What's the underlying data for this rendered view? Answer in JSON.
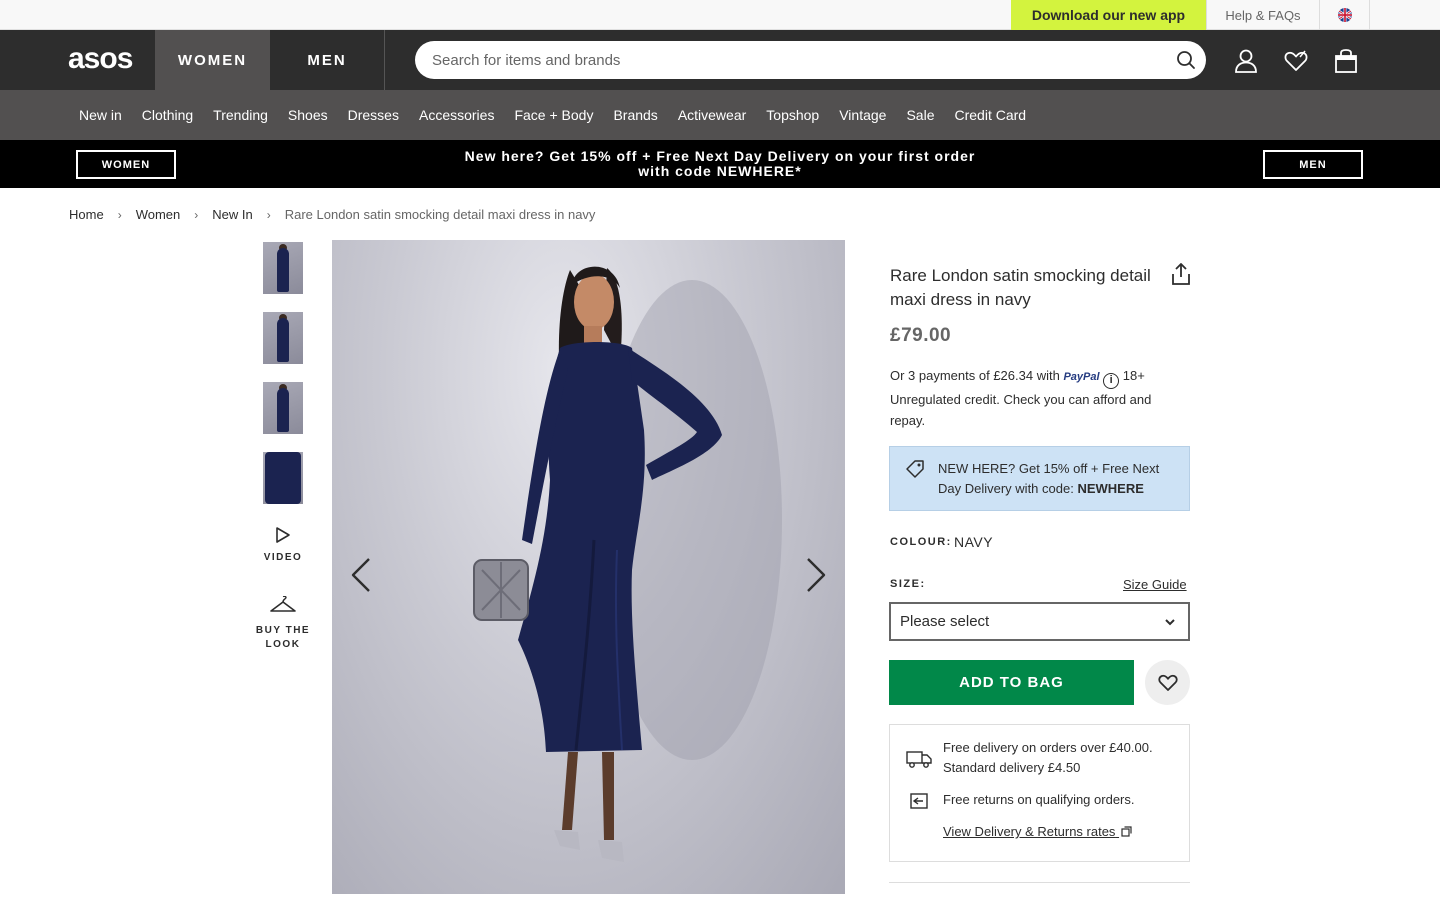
{
  "utility": {
    "download_app": "Download our new app",
    "help": "Help & FAQs",
    "flag_icon": "uk-flag-icon"
  },
  "header": {
    "logo": "asos",
    "tabs": [
      "WOMEN",
      "MEN"
    ],
    "active_tab": "WOMEN",
    "search_placeholder": "Search for items and brands",
    "icons": [
      "search-icon",
      "account-icon",
      "saved-items-icon",
      "bag-icon"
    ]
  },
  "category_nav": [
    "New in",
    "Clothing",
    "Trending",
    "Shoes",
    "Dresses",
    "Accessories",
    "Face + Body",
    "Brands",
    "Activewear",
    "Topshop",
    "Vintage",
    "Sale",
    "Credit Card"
  ],
  "promo_banner": {
    "women_button": "WOMEN",
    "men_button": "MEN",
    "line1": "New here? Get 15% off + Free Next Day Delivery on your first order",
    "line2": "with code NEWHERE*"
  },
  "breadcrumb": [
    "Home",
    "Women",
    "New In",
    "Rare London satin smocking detail maxi dress in navy"
  ],
  "gallery": {
    "video_label": "VIDEO",
    "buy_the_look_label": "BUY THE LOOK",
    "thumbnail_count": 4,
    "image_description_color": "#1b2350"
  },
  "product": {
    "title": "Rare London satin smocking detail maxi dress in navy",
    "price": "£79.00",
    "paypal": {
      "prefix": "Or 3 payments of £26.34 with",
      "brand": "PayPal",
      "suffix": "18+",
      "line2": "Unregulated credit. Check you can afford and repay."
    },
    "promo": {
      "text": "NEW HERE? Get 15% off + Free Next Day Delivery with code:",
      "code": "NEWHERE"
    },
    "colour_label": "COLOUR:",
    "colour_value": "NAVY",
    "size_label": "SIZE:",
    "size_guide": "Size Guide",
    "size_placeholder": "Please select",
    "add_to_bag": "ADD TO BAG"
  },
  "delivery": {
    "line1": "Free delivery on orders over £40.00.",
    "line2": "Standard delivery £4.50",
    "returns": "Free returns on qualifying orders.",
    "link": "View Delivery & Returns rates"
  },
  "colors": {
    "accent_green": "#018849",
    "app_yellow": "#d3f33e",
    "header_dark": "#2d2d2d",
    "nav_grey": "#525050",
    "promo_blue": "#cde2f5"
  }
}
